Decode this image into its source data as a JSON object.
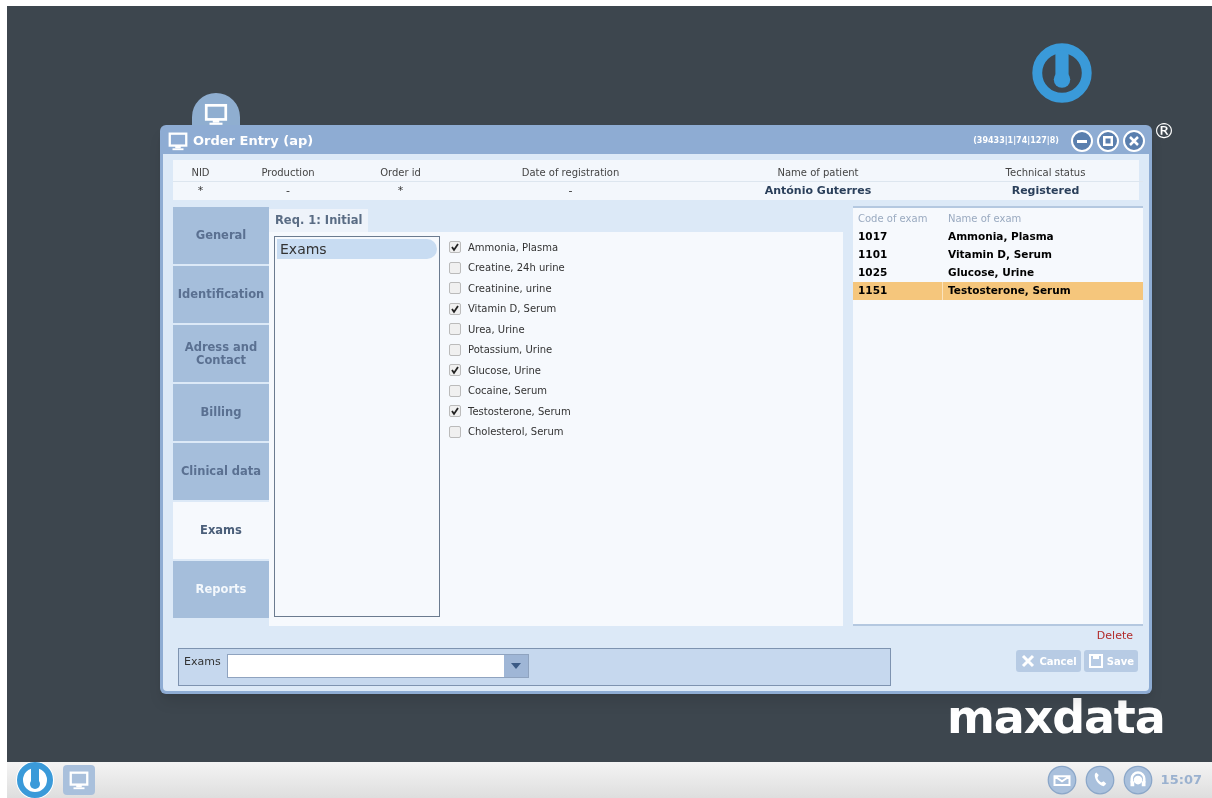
{
  "window": {
    "title": "Order Entry (ap)",
    "session_info": "(39433|1|74|127|8)"
  },
  "header": [
    {
      "label": "NID",
      "value": "*"
    },
    {
      "label": "Production",
      "value": "-"
    },
    {
      "label": "Order id",
      "value": "*"
    },
    {
      "label": "Date of registration",
      "value": "-"
    },
    {
      "label": "Name of patient",
      "value": "António Guterres"
    },
    {
      "label": "Technical status",
      "value": "Registered"
    }
  ],
  "tabs": [
    {
      "label": "General",
      "selected": false,
      "disabled": false
    },
    {
      "label": "Identification",
      "selected": false,
      "disabled": false
    },
    {
      "label": "Adress and Contact",
      "selected": false,
      "disabled": false
    },
    {
      "label": "Billing",
      "selected": false,
      "disabled": false
    },
    {
      "label": "Clinical data",
      "selected": false,
      "disabled": false
    },
    {
      "label": "Exams",
      "selected": true,
      "disabled": false
    },
    {
      "label": "Reports",
      "selected": false,
      "disabled": true
    }
  ],
  "request_tab": "Req. 1: Initial",
  "groups": [
    {
      "label": "Exams",
      "selected": true
    }
  ],
  "exam_options": [
    {
      "label": "Ammonia, Plasma",
      "checked": true
    },
    {
      "label": "Creatine, 24h urine",
      "checked": false
    },
    {
      "label": "Creatinine, urine",
      "checked": false
    },
    {
      "label": "Vitamin D, Serum",
      "checked": true
    },
    {
      "label": "Urea, Urine",
      "checked": false
    },
    {
      "label": "Potassium, Urine",
      "checked": false
    },
    {
      "label": "Glucose, Urine",
      "checked": true
    },
    {
      "label": "Cocaine, Serum",
      "checked": false
    },
    {
      "label": "Testosterone, Serum",
      "checked": true
    },
    {
      "label": "Cholesterol, Serum",
      "checked": false
    }
  ],
  "selected_exams": {
    "columns": [
      "Code of exam",
      "Name of exam"
    ],
    "rows": [
      {
        "code": "1017",
        "name": "Ammonia, Plasma",
        "selected": false
      },
      {
        "code": "1101",
        "name": "Vitamin D, Serum",
        "selected": false
      },
      {
        "code": "1025",
        "name": "Glucose, Urine",
        "selected": false
      },
      {
        "code": "1151",
        "name": "Testosterone, Serum",
        "selected": true
      }
    ]
  },
  "delete_link": "Delete",
  "exam_search": {
    "label": "Exams"
  },
  "buttons": [
    {
      "label": "Cancel",
      "kind": "cancel",
      "disabled": true
    },
    {
      "label": "Save",
      "kind": "save",
      "disabled": true
    }
  ],
  "branding": {
    "registered": "®",
    "maxdata": "maxdata"
  },
  "taskbar": {
    "clock": "15:07"
  }
}
